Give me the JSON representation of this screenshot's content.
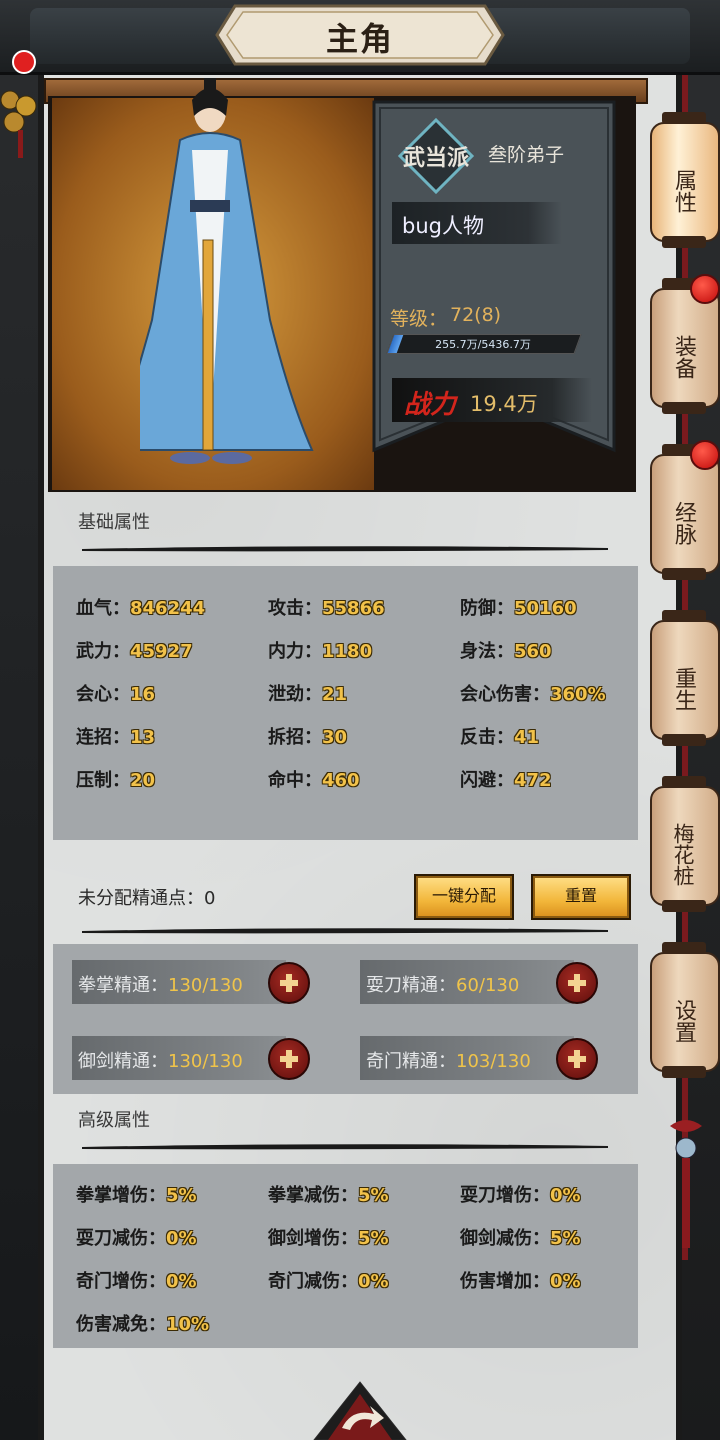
{
  "header": {
    "title": "主角"
  },
  "profile": {
    "sect": "武当派",
    "rank": "叁阶弟子",
    "name": "bug人物",
    "level_label": "等级：",
    "level_value": "72(8)",
    "exp_text": "255.7万/5436.7万",
    "exp_fraction": 0.047,
    "power_label": "战力",
    "power_value": "19.4万"
  },
  "side_tabs": [
    {
      "label": "属性",
      "active": true,
      "badge": false
    },
    {
      "label": "装备",
      "active": false,
      "badge": true
    },
    {
      "label": "经脉",
      "active": false,
      "badge": true
    },
    {
      "label": "重生",
      "active": false,
      "badge": false
    },
    {
      "label": "梅花桩",
      "active": false,
      "badge": false
    },
    {
      "label": "设置",
      "active": false,
      "badge": false
    }
  ],
  "basic": {
    "title": "基础属性",
    "stats": [
      {
        "label": "血气：",
        "value": "846244"
      },
      {
        "label": "攻击：",
        "value": "55866"
      },
      {
        "label": "防御：",
        "value": "50160"
      },
      {
        "label": "武力：",
        "value": "45927"
      },
      {
        "label": "内力：",
        "value": "1180"
      },
      {
        "label": "身法：",
        "value": "560"
      },
      {
        "label": "会心：",
        "value": "16"
      },
      {
        "label": "泄劲：",
        "value": "21"
      },
      {
        "label": "会心伤害：",
        "value": "360%"
      },
      {
        "label": "连招：",
        "value": "13"
      },
      {
        "label": "拆招：",
        "value": "30"
      },
      {
        "label": "反击：",
        "value": "41"
      },
      {
        "label": "压制：",
        "value": "20"
      },
      {
        "label": "命中：",
        "value": "460"
      },
      {
        "label": "闪避：",
        "value": "472"
      }
    ]
  },
  "mastery": {
    "unassigned": "未分配精通点：0",
    "auto_button": "一键分配",
    "reset_button": "重置",
    "items": [
      {
        "label": "拳掌精通：",
        "value": "130/130"
      },
      {
        "label": "耍刀精通：",
        "value": "60/130"
      },
      {
        "label": "御剑精通：",
        "value": "130/130"
      },
      {
        "label": "奇门精通：",
        "value": "103/130"
      }
    ]
  },
  "advanced": {
    "title": "高级属性",
    "stats": [
      {
        "label": "拳掌增伤：",
        "value": "5%"
      },
      {
        "label": "拳掌减伤：",
        "value": "5%"
      },
      {
        "label": "耍刀增伤：",
        "value": "0%"
      },
      {
        "label": "耍刀减伤：",
        "value": "0%"
      },
      {
        "label": "御剑增伤：",
        "value": "5%"
      },
      {
        "label": "御剑减伤：",
        "value": "5%"
      },
      {
        "label": "奇门增伤：",
        "value": "0%"
      },
      {
        "label": "奇门减伤：",
        "value": "0%"
      },
      {
        "label": "伤害增加：",
        "value": "0%"
      },
      {
        "label": "伤害减免：",
        "value": "10%"
      }
    ]
  },
  "colors": {
    "value_gold": "#f2c24a",
    "power_red": "#d3251c",
    "badge_red": "#e02020"
  }
}
